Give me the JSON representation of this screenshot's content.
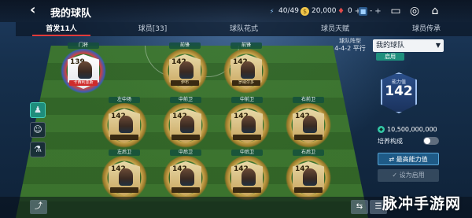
{
  "header": {
    "title": "我的球队",
    "resources": [
      {
        "icon": "energy-icon",
        "value": "40/49",
        "color": "#8ec9ff"
      },
      {
        "icon": "coin-icon",
        "value": "20,000",
        "color": "#f1c64a"
      },
      {
        "icon": "gem-icon",
        "value": "0",
        "color": "#e04a4a"
      },
      {
        "icon": "token-icon",
        "value": "-",
        "color": "#5aa8e8"
      }
    ]
  },
  "tabs": [
    {
      "label": "首发11人",
      "active": true
    },
    {
      "label": "球员[33]",
      "active": false
    },
    {
      "label": "球队花式",
      "active": false
    },
    {
      "label": "球员天赋",
      "active": false
    },
    {
      "label": "球员传承",
      "active": false
    }
  ],
  "formation": {
    "label_line1": "球队阵型",
    "label_line2": "4-4-2 平行"
  },
  "team_select": {
    "value": "我的球队"
  },
  "active_tag": "启用",
  "ability": {
    "label": "能力值",
    "value": "142"
  },
  "coins": "10,500,000,000",
  "cultivate_label": "培养构成",
  "buttons": {
    "best_ability": "最高能力值",
    "set_active": "设为启用"
  },
  "watermark": "脉冲手游网",
  "players": [
    {
      "id": "gk",
      "pos": "门将",
      "ovr": "139",
      "name": "卡西利亚斯",
      "gk": true
    },
    {
      "id": "st1",
      "pos": "前锋",
      "ovr": "142",
      "name": "伊布",
      "gk": false
    },
    {
      "id": "st2",
      "pos": "前锋",
      "ovr": "142",
      "name": "罗纳尔多",
      "gk": false
    },
    {
      "id": "lm",
      "pos": "左中场",
      "ovr": "142",
      "name": "",
      "gk": false
    },
    {
      "id": "cm1",
      "pos": "中前卫",
      "ovr": "142",
      "name": "",
      "gk": false
    },
    {
      "id": "cm2",
      "pos": "中前卫",
      "ovr": "142",
      "name": "",
      "gk": false
    },
    {
      "id": "rm",
      "pos": "右前卫",
      "ovr": "142",
      "name": "",
      "gk": false
    },
    {
      "id": "lb",
      "pos": "左后卫",
      "ovr": "142",
      "name": "",
      "gk": false
    },
    {
      "id": "cb1",
      "pos": "中后卫",
      "ovr": "142",
      "name": "",
      "gk": false
    },
    {
      "id": "cb2",
      "pos": "中后卫",
      "ovr": "142",
      "name": "",
      "gk": false
    },
    {
      "id": "rb",
      "pos": "右后卫",
      "ovr": "142",
      "name": "",
      "gk": false
    }
  ]
}
